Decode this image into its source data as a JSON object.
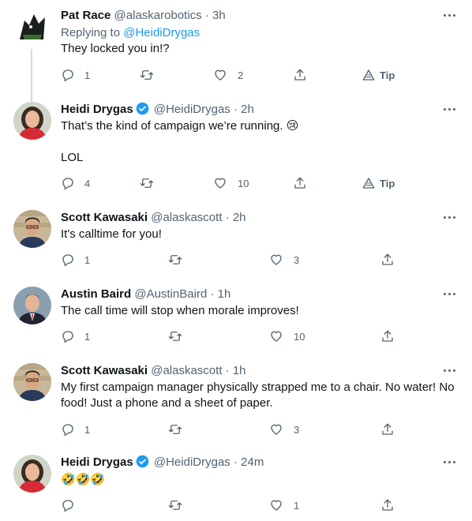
{
  "tweets": [
    {
      "name": "Pat Race",
      "handle": "@alaskarobotics",
      "time": "3h",
      "verified": false,
      "replying_prefix": "Replying to ",
      "replying_to": "@HeidiDrygas",
      "text": "They locked you in!?",
      "replies": "1",
      "retweets": "",
      "likes": "2",
      "tip_label": "Tip"
    },
    {
      "name": "Heidi Drygas",
      "handle": "@HeidiDrygas",
      "time": "2h",
      "verified": true,
      "text": "That’s the kind of campaign we’re running. 😢\n\nLOL",
      "replies": "4",
      "retweets": "",
      "likes": "10",
      "tip_label": "Tip"
    },
    {
      "name": "Scott Kawasaki",
      "handle": "@alaskascott",
      "time": "2h",
      "verified": false,
      "text": "It's calltime for you!",
      "replies": "1",
      "retweets": "",
      "likes": "3"
    },
    {
      "name": "Austin Baird",
      "handle": "@AustinBaird",
      "time": "1h",
      "verified": false,
      "text": "The call time will stop when morale improves!",
      "replies": "1",
      "retweets": "",
      "likes": "10"
    },
    {
      "name": "Scott Kawasaki",
      "handle": "@alaskascott",
      "time": "1h",
      "verified": false,
      "text": "My first campaign manager physically strapped me to a chair. No water! No food! Just a phone and a sheet of paper.",
      "replies": "1",
      "retweets": "",
      "likes": "3"
    },
    {
      "name": "Heidi Drygas",
      "handle": "@HeidiDrygas",
      "time": "24m",
      "verified": true,
      "text": "🤣🤣🤣",
      "replies": "",
      "retweets": "",
      "likes": "1"
    }
  ],
  "separator": "·",
  "colors": {
    "text": "#0f1419",
    "muted": "#536471",
    "link": "#1d9bf0",
    "verified": "#1d9bf0",
    "thread_line": "#cfd9de"
  }
}
